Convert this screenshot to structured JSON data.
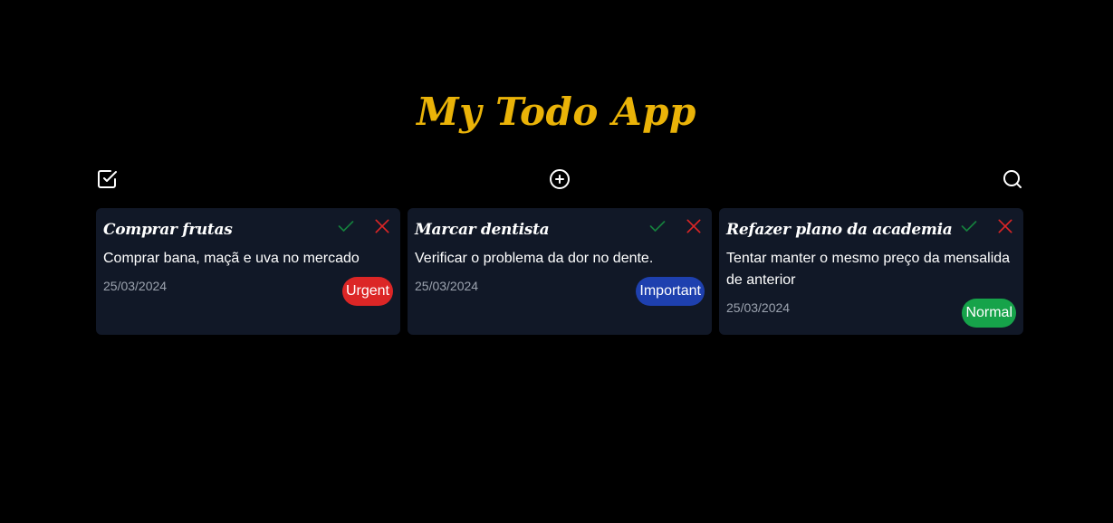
{
  "app": {
    "title": "My Todo App"
  },
  "toolbar": {
    "left_icon": "check-square-icon",
    "center_icon": "plus-circle-icon",
    "right_icon": "search-icon"
  },
  "colors": {
    "title": "#eab308",
    "card_bg": "#111827",
    "check": "#15803d",
    "close": "#dc2626",
    "urgent": "#dc2626",
    "important": "#1e40af",
    "normal": "#16a34a"
  },
  "todos": [
    {
      "title": "Comprar frutas",
      "description": "Comprar bana, maçã e uva no mercado",
      "date": "25/03/2024",
      "priority": "Urgent",
      "priority_color": "#dc2626"
    },
    {
      "title": "Marcar dentista",
      "description": "Verificar o problema da dor no dente.",
      "date": "25/03/2024",
      "priority": "Important",
      "priority_color": "#1e40af"
    },
    {
      "title": "Refazer plano da academia",
      "description": "Tentar manter o mesmo preço da mensalida de anterior",
      "date": "25/03/2024",
      "priority": "Normal",
      "priority_color": "#16a34a"
    }
  ]
}
